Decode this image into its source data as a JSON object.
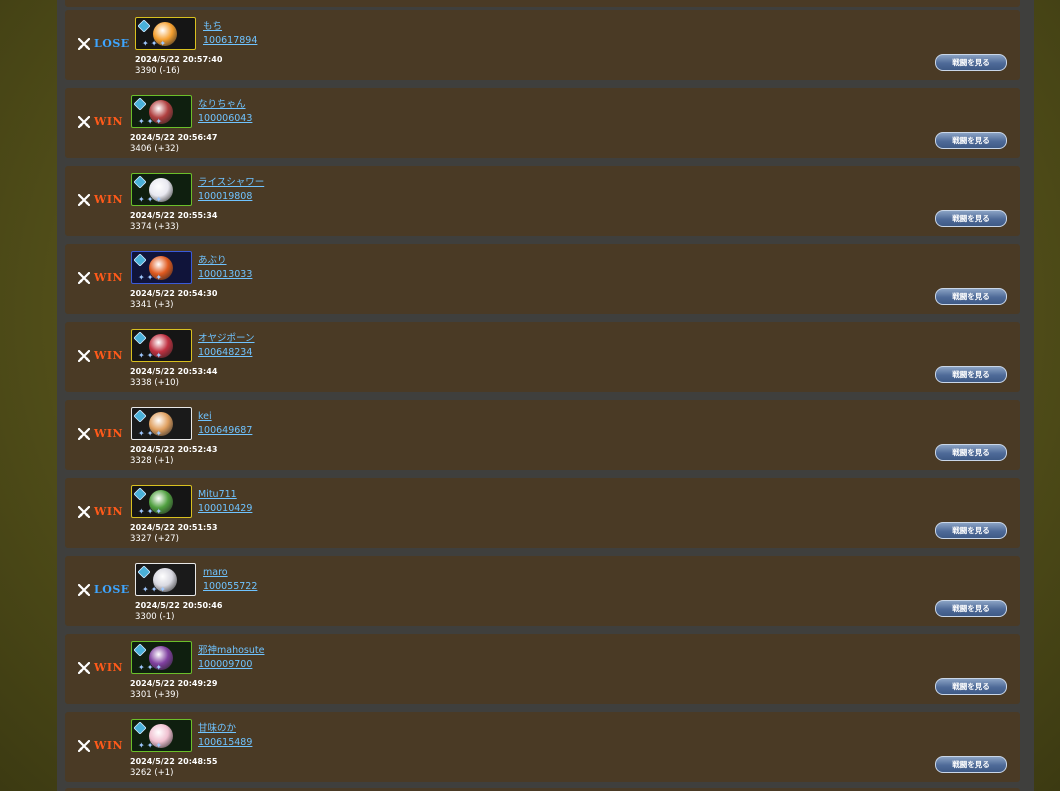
{
  "results": [
    {
      "outcome": "LOSE",
      "name": "もち",
      "player_id": "100617894",
      "datetime": "2024/5/22 20:57:40",
      "score": "3390 (-16)",
      "watch_label": "戦闘を見る",
      "deck_border": "yellow",
      "avatar_color": "#f5a030"
    },
    {
      "outcome": "WIN",
      "name": "なりちゃん",
      "player_id": "100006043",
      "datetime": "2024/5/22 20:56:47",
      "score": "3406 (+32)",
      "watch_label": "戦闘を見る",
      "deck_border": "green",
      "avatar_color": "#b04040"
    },
    {
      "outcome": "WIN",
      "name": "ライスシャワー",
      "player_id": "100019808",
      "datetime": "2024/5/22 20:55:34",
      "score": "3374 (+33)",
      "watch_label": "戦闘を見る",
      "deck_border": "green",
      "avatar_color": "#e8e8f0"
    },
    {
      "outcome": "WIN",
      "name": "あぶり",
      "player_id": "100013033",
      "datetime": "2024/5/22 20:54:30",
      "score": "3341 (+3)",
      "watch_label": "戦闘を見る",
      "deck_border": "blue",
      "avatar_color": "#e05a20"
    },
    {
      "outcome": "WIN",
      "name": "オヤジポーン",
      "player_id": "100648234",
      "datetime": "2024/5/22 20:53:44",
      "score": "3338 (+10)",
      "watch_label": "戦闘を見る",
      "deck_border": "yellow",
      "avatar_color": "#c03040"
    },
    {
      "outcome": "WIN",
      "name": "kei",
      "player_id": "100649687",
      "datetime": "2024/5/22 20:52:43",
      "score": "3328 (+1)",
      "watch_label": "戦闘を見る",
      "deck_border": "white",
      "avatar_color": "#e0a060"
    },
    {
      "outcome": "WIN",
      "name": "Mitu711",
      "player_id": "100010429",
      "datetime": "2024/5/22 20:51:53",
      "score": "3327 (+27)",
      "watch_label": "戦闘を見る",
      "deck_border": "yellow",
      "avatar_color": "#50a040"
    },
    {
      "outcome": "LOSE",
      "name": "maro",
      "player_id": "100055722",
      "datetime": "2024/5/22 20:50:46",
      "score": "3300 (-1)",
      "watch_label": "戦闘を見る",
      "deck_border": "white",
      "avatar_color": "#d8d8e0"
    },
    {
      "outcome": "WIN",
      "name": "邪神mahosute",
      "player_id": "100009700",
      "datetime": "2024/5/22 20:49:29",
      "score": "3301 (+39)",
      "watch_label": "戦闘を見る",
      "deck_border": "green",
      "avatar_color": "#8040a0"
    },
    {
      "outcome": "WIN",
      "name": "甘味のか",
      "player_id": "100615489",
      "datetime": "2024/5/22 20:48:55",
      "score": "3262 (+1)",
      "watch_label": "戦闘を見る",
      "deck_border": "green",
      "avatar_color": "#f0c0d0"
    }
  ],
  "colors": {
    "win": "#ff5a1a",
    "lose": "#3ea5ff",
    "row_bg": "#4a3a25",
    "link": "#6fc3ff",
    "button": "#4e6a98"
  }
}
